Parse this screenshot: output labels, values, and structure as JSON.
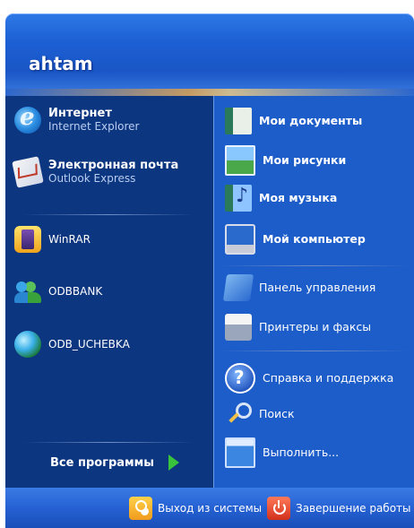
{
  "user": {
    "name": "ahtam"
  },
  "left": {
    "pinned": [
      {
        "main": "Интернет",
        "sub": "Internet Explorer",
        "icon": "internet-explorer-icon"
      },
      {
        "main": "Электронная почта",
        "sub": "Outlook Express",
        "icon": "outlook-express-icon"
      }
    ],
    "recent": [
      {
        "label": "WinRAR",
        "icon": "winrar-icon"
      },
      {
        "label": "ODBBANK",
        "icon": "people-icon"
      },
      {
        "label": "ODB_UCHEBKA",
        "icon": "globe-icon"
      }
    ],
    "all_programs": "Все программы"
  },
  "right": {
    "items": [
      {
        "label": "Мои документы",
        "icon": "my-documents-icon",
        "bold": true
      },
      {
        "label": "Мои рисунки",
        "icon": "my-pictures-icon",
        "bold": true
      },
      {
        "label": "Моя музыка",
        "icon": "my-music-icon",
        "bold": true
      },
      {
        "label": "Мой компьютер",
        "icon": "my-computer-icon",
        "bold": true
      },
      {
        "label": "Панель управления",
        "icon": "control-panel-icon",
        "bold": false
      },
      {
        "label": "Принтеры и факсы",
        "icon": "printers-icon",
        "bold": false
      },
      {
        "label": "Справка и поддержка",
        "icon": "help-icon",
        "bold": false
      },
      {
        "label": "Поиск",
        "icon": "search-icon",
        "bold": false
      },
      {
        "label": "Выполнить...",
        "icon": "run-icon",
        "bold": false
      }
    ]
  },
  "footer": {
    "logoff": "Выход из системы",
    "shutdown": "Завершение работы"
  },
  "colors": {
    "left_bg": "#0d3680",
    "right_bg": "#1d5dc9",
    "header": "#1c5fd4",
    "all_programs_arrow": "#39c23b"
  }
}
